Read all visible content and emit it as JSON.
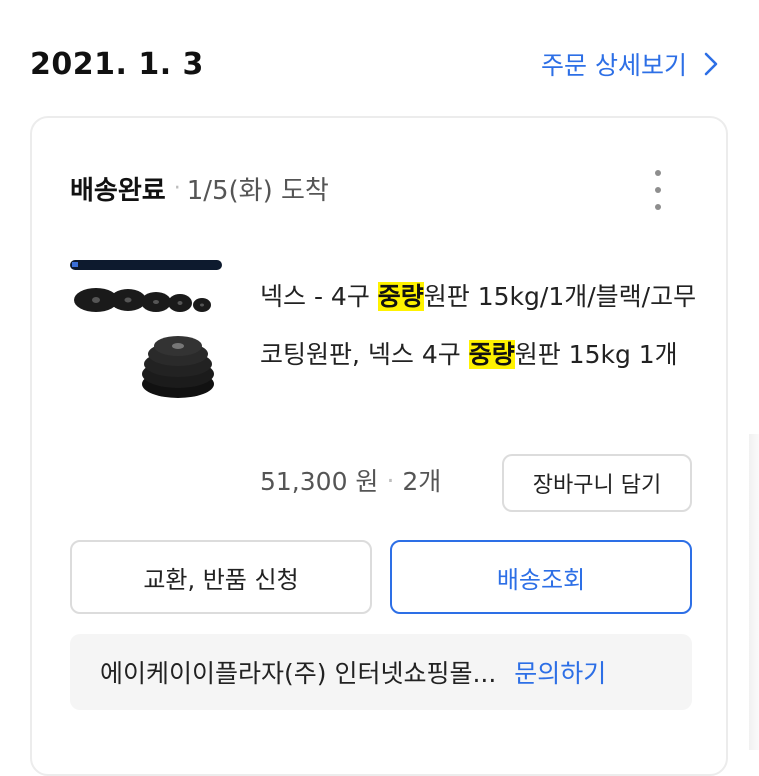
{
  "order": {
    "date": "2021. 1. 3",
    "detail_link": "주문 상세보기"
  },
  "card": {
    "status": "배송완료",
    "separator": "·",
    "arrival": "1/5(화) 도착",
    "product": {
      "title_parts": {
        "p1": "넥스 - 4구 ",
        "h1": "중량",
        "p2": "원판 15kg/1개/블랙/고무코팅원판, 넥스 4구 ",
        "h2": "중량",
        "p3": "원판 15kg 1개"
      },
      "price": "51,300 원",
      "quantity": "2개",
      "thumbnail_icon": "weight-plates-image"
    },
    "add_to_cart": "장바구니 담기",
    "exchange_button": "교환, 반품 신청",
    "tracking_button": "배송조회",
    "seller": "에이케이이플라자(주) 인터넷쇼핑몰...",
    "inquiry": "문의하기"
  },
  "colors": {
    "accent": "#2d6fe6",
    "highlight": "#fff200",
    "muted": "#555555",
    "border": "#dcdcdc",
    "seller_bg": "#f5f5f5"
  }
}
